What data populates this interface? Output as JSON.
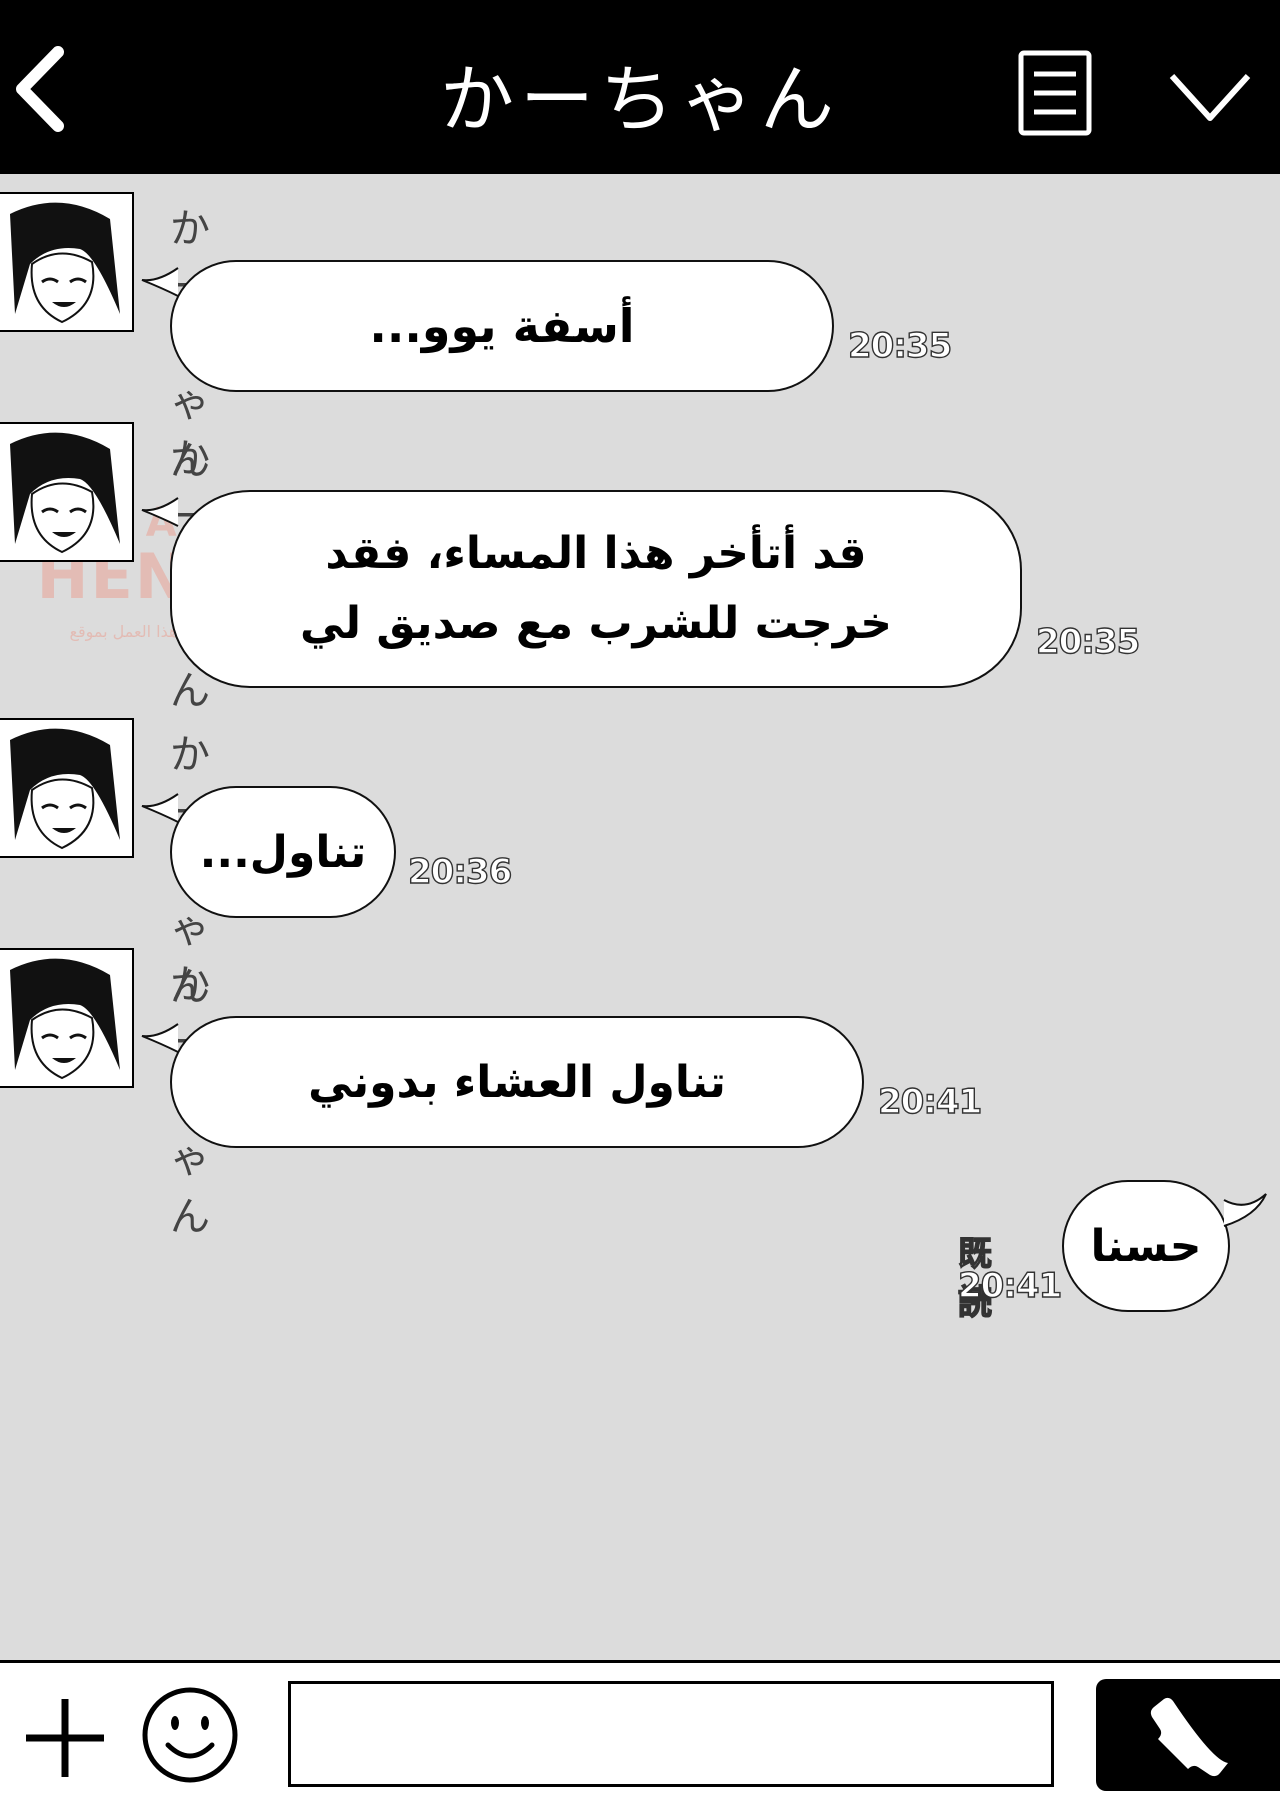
{
  "header": {
    "title": "かーちゃん"
  },
  "messages": [
    {
      "sender": "かーちゃん",
      "text": "أسفة يوو...",
      "time": "20:35"
    },
    {
      "sender": "かーちゃん",
      "line1": "قد أتأخر هذا المساء، فقد",
      "line2": "خرجت للشرب مع صديق لي",
      "time": "20:35"
    },
    {
      "sender": "かーちゃん",
      "text": "تناول...",
      "time": "20:36"
    },
    {
      "sender": "かーちゃん",
      "text": "تناول العشاء بدوني",
      "time": "20:41"
    }
  ],
  "reply": {
    "text": "حسنا",
    "read_label": "既読",
    "time": "20:41"
  },
  "watermark": {
    "brand_top": "ARABS",
    "brand_main": "HENTAI",
    "note": "لا تنس متابعة هذا العمل بموقع"
  },
  "input": {
    "placeholder": ""
  },
  "icons": {
    "back": "chevron-left-icon",
    "menu": "menu-icon",
    "collapse": "chevron-down-icon",
    "add": "plus-icon",
    "emoji": "smiley-icon",
    "call": "phone-icon"
  }
}
